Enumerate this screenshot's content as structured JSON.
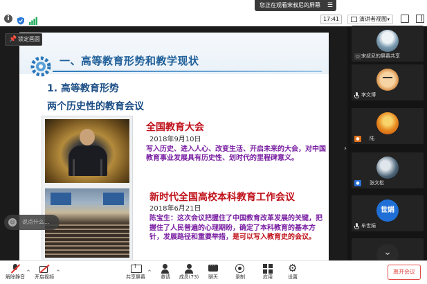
{
  "top_bar": {
    "share_banner_text": "您正在观看宋叔尼的屏幕",
    "time": "17:41",
    "view_mode_label": "演讲者视图"
  },
  "stage": {
    "lock_label": "锁定画面",
    "chat_placeholder": "说点什么..."
  },
  "slide": {
    "section_title": "一、高等教育形势和教学现状",
    "subtitle_1": "1. 高等教育形势",
    "subtitle_2": "两个历史性的教育会议",
    "event1": {
      "title": "全国教育大会",
      "date": "2018年9月10日",
      "description": "写入历史、进入人心、改变生活、开启未来的大会，对中国教育事业发展具有历史性、划时代的里程碑意义。"
    },
    "event2": {
      "title": "新时代全国高校本科教育工作会议",
      "date": "2018年6月21日",
      "desc_part1": "陈宝生：这次会议把握住了中国教育改革发展的关键，把握住了人民普遍的心理期盼，确定了本科教育的基本方针，发展路径和重要举措，",
      "desc_part2": "是可以写入教育史的会议。"
    }
  },
  "participants": [
    {
      "name": "宋叔尼的屏幕共享",
      "avatar": "landscape",
      "badge": "screen-share"
    },
    {
      "name": "李文博",
      "avatar": "cartoon",
      "badge": "mic"
    },
    {
      "name": "陆",
      "avatar": "orange",
      "badge": "person-orange"
    },
    {
      "name": "张文松",
      "avatar": "cross",
      "badge": "person-blue"
    },
    {
      "name": "牟世娟",
      "avatar": "text",
      "avatar_text": "世娟",
      "badge": "mic"
    },
    {
      "name": "",
      "avatar": "cut",
      "badge": ""
    }
  ],
  "bottom_bar": {
    "unmute_label": "解除静音",
    "video_label": "开启视频",
    "share_label": "共享屏幕",
    "invite_label": "邀请",
    "members_label": "成员(73)",
    "chat_label": "聊天",
    "record_label": "录制",
    "apps_label": "应用",
    "settings_label": "设置",
    "leave_label": "离开会议"
  },
  "colors": {
    "title_blue": "#1f5f99",
    "event_red": "#c0121b",
    "desc_purple": "#7a1fa2",
    "leave_red": "#e24a44"
  }
}
